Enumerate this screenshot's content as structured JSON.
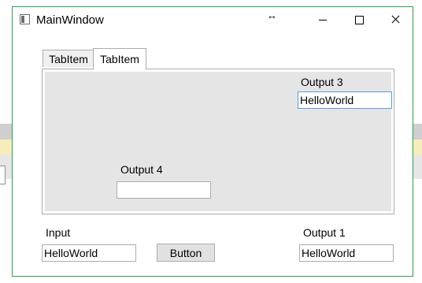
{
  "window": {
    "title": "MainWindow",
    "icon": "app-window-icon",
    "border_color": "#2fa24a",
    "caption_buttons": [
      "minimize-icon",
      "maximize-icon",
      "close-icon"
    ]
  },
  "tabs": [
    {
      "label": "TabItem",
      "selected": false
    },
    {
      "label": "TabItem",
      "selected": true
    }
  ],
  "tab_content": {
    "background": "#e5e5e5",
    "output3": {
      "label": "Output 3",
      "value": "HelloWorld"
    },
    "output4": {
      "label": "Output 4",
      "value": ""
    }
  },
  "form": {
    "input_label": "Input",
    "input_value": "HelloWorld",
    "button_label": "Button",
    "output1_label": "Output 1",
    "output1_value": "HelloWorld"
  }
}
